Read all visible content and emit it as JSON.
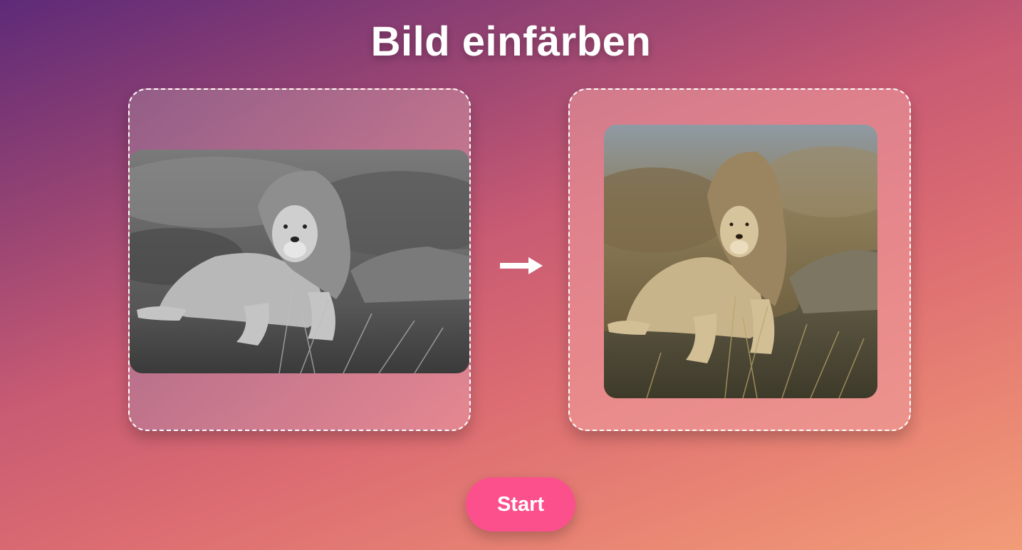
{
  "page": {
    "title": "Bild einfärben"
  },
  "input_panel": {
    "image_semantic": "black-and-white lion lying on rock",
    "style": "grayscale"
  },
  "output_panel": {
    "image_semantic": "colorized lion lying on rock",
    "style": "color"
  },
  "arrow": {
    "icon": "arrow-right-icon",
    "color": "#ffffff"
  },
  "actions": {
    "start_label": "Start",
    "start_color": "#fb508b"
  },
  "colors": {
    "gradient_start": "#5e2a78",
    "gradient_end": "#f29c78",
    "panel_border": "#ffffff"
  }
}
